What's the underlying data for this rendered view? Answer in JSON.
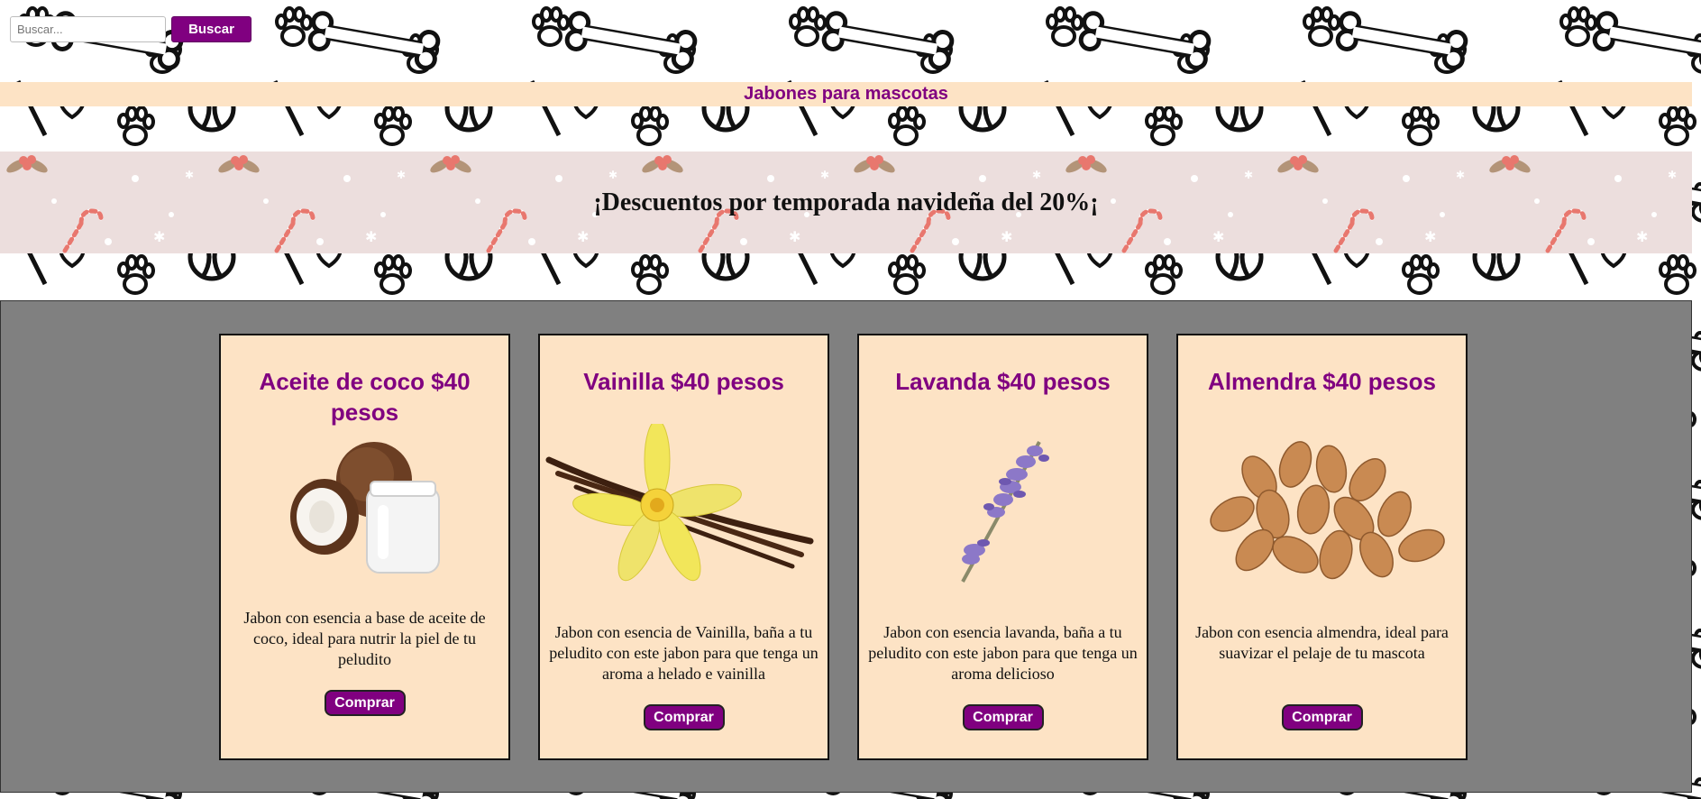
{
  "search": {
    "placeholder": "Buscar...",
    "button_label": "Buscar"
  },
  "header": {
    "title": "Jabones para mascotas"
  },
  "promo": {
    "text": "¡Descuentos por temporada navideña del 20%¡"
  },
  "products": [
    {
      "title": "Aceite de coco $40 pesos",
      "image_icon": "coconut-oil-image",
      "description": "Jabon con esencia a base de aceite de coco, ideal para nutrir la piel de tu peludito",
      "button_label": "Comprar"
    },
    {
      "title": "Vainilla $40 pesos",
      "image_icon": "vanilla-flower-image",
      "description": "Jabon con esencia de Vainilla, baña a tu peludito con este jabon para que tenga un aroma a helado e vainilla",
      "button_label": "Comprar"
    },
    {
      "title": "Lavanda $40 pesos",
      "image_icon": "lavender-image",
      "description": "Jabon con esencia lavanda, baña a tu peludito con este jabon para que tenga un aroma delicioso",
      "button_label": "Comprar"
    },
    {
      "title": "Almendra $40 pesos",
      "image_icon": "almonds-image",
      "description": "Jabon con esencia almendra, ideal para suavizar el pelaje de tu mascota",
      "button_label": "Comprar"
    }
  ],
  "colors": {
    "brand_purple": "#800080",
    "card_background": "#fde3c5",
    "products_background": "#808080",
    "promo_background": "#ecdedd"
  }
}
